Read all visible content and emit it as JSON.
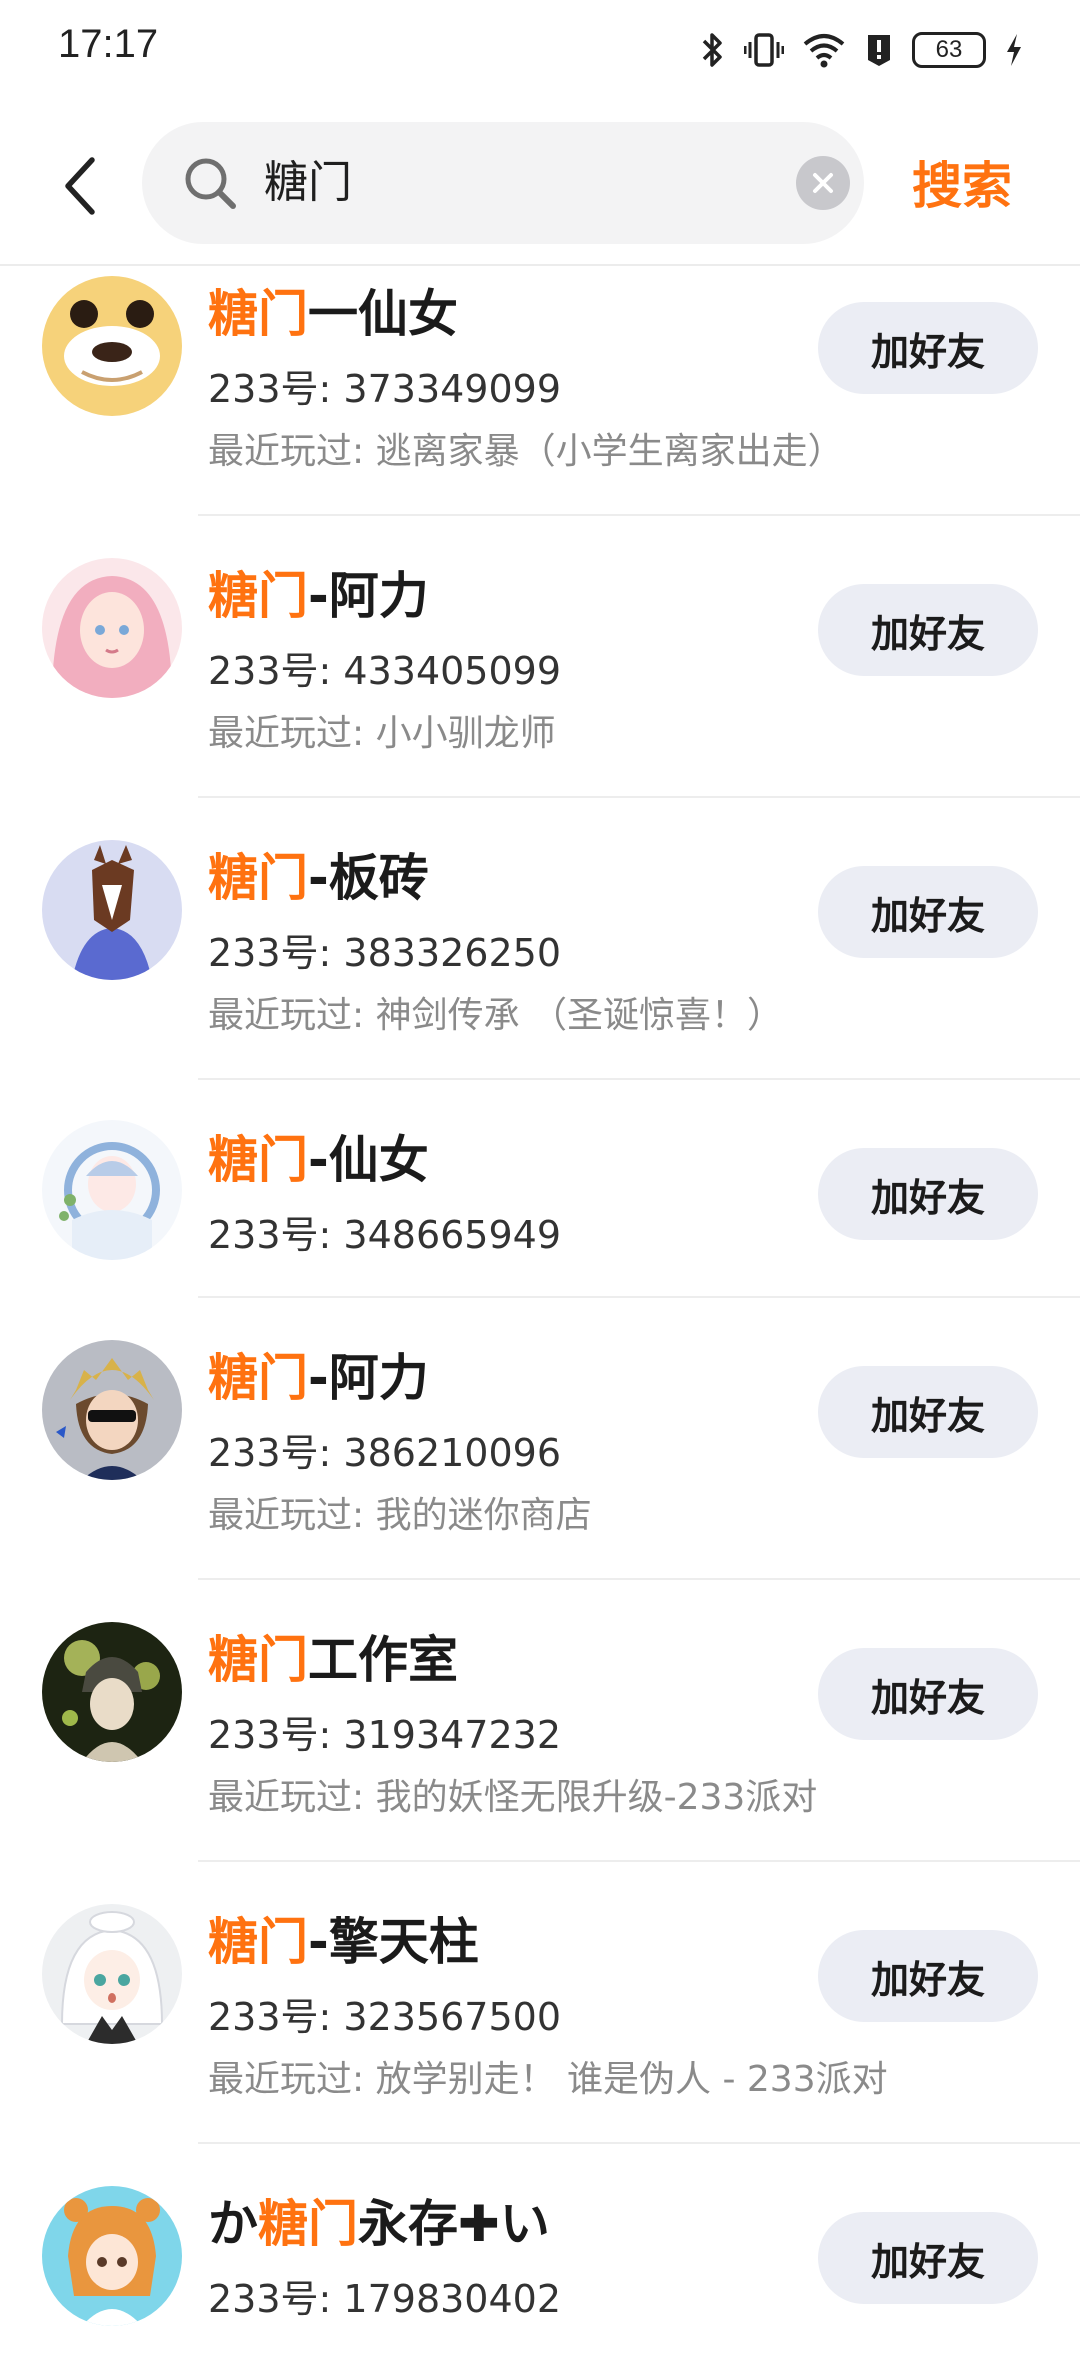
{
  "status_bar": {
    "time": "17:17",
    "battery": "63",
    "icons": [
      "bluetooth-icon",
      "vibrate-icon",
      "wifi-icon",
      "alert-icon",
      "battery-icon",
      "charging-icon"
    ]
  },
  "search": {
    "query": "糖门",
    "submit_label": "搜索"
  },
  "colors": {
    "accent": "#ff7210",
    "button_bg": "#ebedf4",
    "secondary_text": "#8a8a8a"
  },
  "results": [
    {
      "name_prefix": "",
      "name_highlight": "糖门",
      "name_suffix": "一仙女",
      "uid": "233号: 373349099",
      "played": "最近玩过: 逃离家暴（小学生离家出走）",
      "button": "加好友"
    },
    {
      "name_prefix": "",
      "name_highlight": "糖门",
      "name_suffix": "-阿力",
      "uid": "233号: 433405099",
      "played": "最近玩过: 小小驯龙师",
      "button": "加好友"
    },
    {
      "name_prefix": "",
      "name_highlight": "糖门",
      "name_suffix": "-板砖",
      "uid": "233号: 383326250",
      "played": "最近玩过: 神剑传承 （圣诞惊喜！）",
      "button": "加好友"
    },
    {
      "name_prefix": "",
      "name_highlight": "糖门",
      "name_suffix": "-仙女",
      "uid": "233号: 348665949",
      "played": "",
      "button": "加好友"
    },
    {
      "name_prefix": "",
      "name_highlight": "糖门",
      "name_suffix": "-阿力",
      "uid": "233号: 386210096",
      "played": "最近玩过: 我的迷你商店",
      "button": "加好友"
    },
    {
      "name_prefix": "",
      "name_highlight": "糖门",
      "name_suffix": "工作室",
      "uid": "233号: 319347232",
      "played": "最近玩过: 我的妖怪无限升级-233派对",
      "button": "加好友"
    },
    {
      "name_prefix": "",
      "name_highlight": "糖门",
      "name_suffix": "-擎天柱",
      "uid": "233号: 323567500",
      "played": "最近玩过: 放学别走！ 谁是伪人 - 233派对",
      "button": "加好友"
    },
    {
      "name_prefix": "か",
      "name_highlight": "糖门",
      "name_suffix": "永存✚い",
      "uid": "233号: 179830402",
      "played": "",
      "button": "加好友"
    }
  ]
}
